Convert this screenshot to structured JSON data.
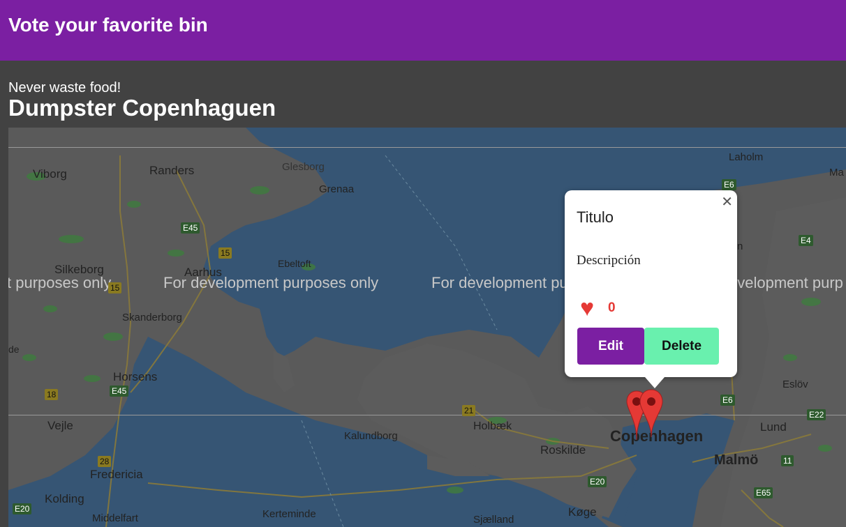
{
  "header": {
    "title": "Vote your favorite bin"
  },
  "intro": {
    "subtitle": "Never waste food!",
    "title": "Dumpster Copenhaguen"
  },
  "map": {
    "watermark": "For development purposes only",
    "watermark_left": "t purposes only",
    "watermark_right": "evelopment purp",
    "cities": {
      "viborg": "Viborg",
      "randers": "Randers",
      "glesborg": "Glesborg",
      "grenaa": "Grenaa",
      "silkeborg": "Silkeborg",
      "aarhus": "Aarhus",
      "ebeltoft": "Ebeltoft",
      "skanderborg": "Skanderborg",
      "horsens": "Horsens",
      "vejle": "Vejle",
      "fredericia": "Fredericia",
      "kolding": "Kolding",
      "middelfart": "Middelfart",
      "kalundborg": "Kalundborg",
      "holbaek": "Holbæk",
      "roskilde": "Roskilde",
      "copenhagen": "Copenhagen",
      "malmo": "Malmö",
      "lund": "Lund",
      "eslov": "Eslöv",
      "koge": "Køge",
      "sjaelland": "Sjælland",
      "kerteminde": "Kerteminde",
      "laholm": "Laholm",
      "ma": "Ma",
      "de": "de",
      "n": "n"
    },
    "roads": [
      "E45",
      "15",
      "E45",
      "18",
      "28",
      "E20",
      "21",
      "E20",
      "E6",
      "E4",
      "E6",
      "E22",
      "11",
      "E65",
      "15"
    ]
  },
  "popup": {
    "title": "Titulo",
    "description": "Descripción",
    "likes": "0",
    "edit_label": "Edit",
    "delete_label": "Delete",
    "close_icon": "close-icon",
    "heart_icon": "heart-icon"
  },
  "colors": {
    "header": "#7b1fa2",
    "edit": "#7b1fa2",
    "delete": "#69f0ae",
    "heart": "#e53935"
  }
}
